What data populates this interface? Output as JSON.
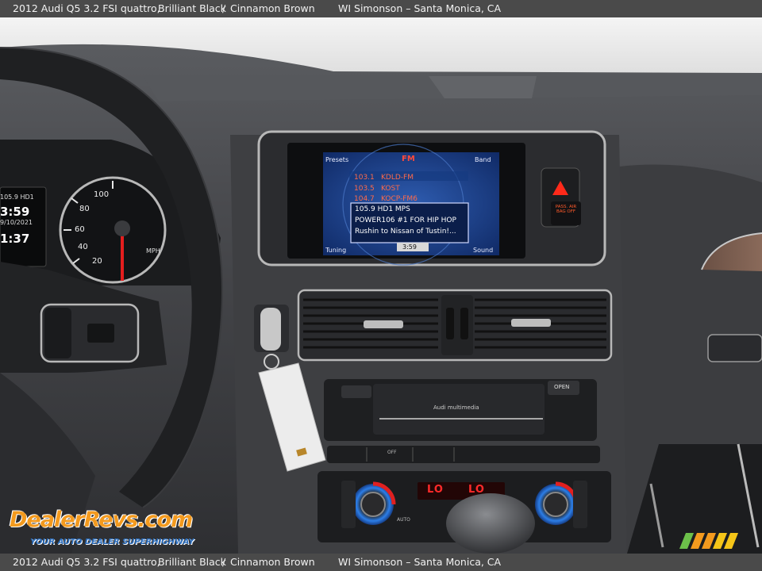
{
  "caption": {
    "vehicle": "2012 Audi Q5 3.2 FSI quattro,",
    "exterior": "Brilliant Black",
    "separator": "/",
    "interior": "Cinnamon Brown",
    "dealer": "WI Simonson – Santa Monica, CA"
  },
  "mmi_screen": {
    "presets": "Presets",
    "band_name": "FM",
    "band_button": "Band",
    "stations": [
      {
        "freq": "103.1",
        "name": "KDLD-FM"
      },
      {
        "freq": "103.5",
        "name": "KOST"
      },
      {
        "freq": "104.7",
        "name": "KOCP-FM6"
      }
    ],
    "info_lines": [
      "105.9 HD1 MPS",
      "POWER106 #1 FOR HIP HOP",
      "Rushin to Nissan of Tustin!..."
    ],
    "tuning": "Tuning",
    "clock": "3:59",
    "sound": "Sound"
  },
  "cluster": {
    "station": "105.9 HD1",
    "time": "3:59",
    "date": "9/10/2021",
    "trip_time": "1:37",
    "speed_unit": "MPH",
    "speed_ticks": [
      "100",
      "80",
      "60",
      "40",
      "20"
    ]
  },
  "console": {
    "passenger_airbag": "PASS. AIR BAG OFF",
    "open_button": "OPEN",
    "media_label": "Audi multimedia",
    "climate_left": "LO",
    "climate_right": "LO",
    "auto_label": "AUTO",
    "off_label": "OFF"
  },
  "watermark": {
    "brand": "DealerRevs.com",
    "tagline": "YOUR AUTO DEALER SUPERHIGHWAY"
  },
  "colors": {
    "caption_bar": "#4a4a4a",
    "screen_bg": "#1a3f8a",
    "climate_led": "#ff2a2a",
    "watermark_orange": "#f39a1e",
    "watermark_blue": "#2c6fbf"
  }
}
